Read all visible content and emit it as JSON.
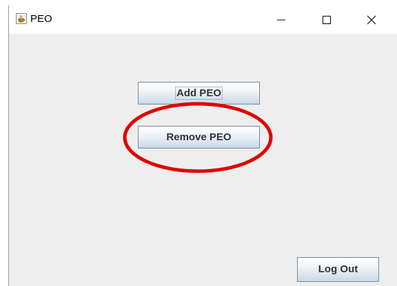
{
  "window": {
    "title": "PEO",
    "app_icon": "java-cup-icon",
    "controls": [
      "minimize-icon",
      "maximize-icon",
      "close-icon"
    ]
  },
  "buttons": {
    "add_label": "Add PEO",
    "remove_label": "Remove PEO",
    "logout_label": "Log Out"
  },
  "annotation": {
    "shape": "ellipse",
    "color": "#e00000",
    "target": "Remove PEO"
  },
  "colors": {
    "window_bg": "#eeeeee",
    "titlebar_bg": "#ffffff",
    "button_text": "#333333"
  }
}
